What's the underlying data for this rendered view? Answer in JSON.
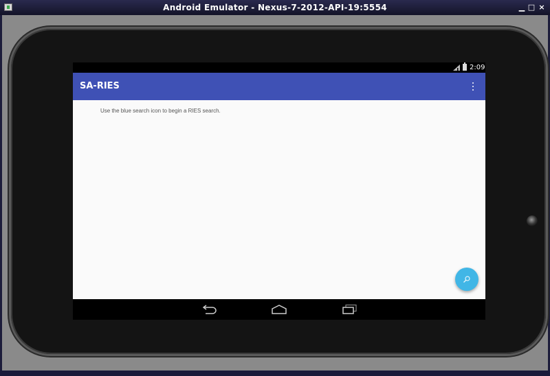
{
  "window": {
    "title": "Android Emulator - Nexus-7-2012-API-19:5554",
    "buttons": {
      "minimize": "▁",
      "maximize": "□",
      "close": "×"
    }
  },
  "status_bar": {
    "time": "2:09",
    "icons": [
      "signal-icon",
      "battery-icon"
    ]
  },
  "app_bar": {
    "title": "SA-RIES",
    "menu_icon": "overflow-menu-icon"
  },
  "content": {
    "hint": "Use the blue search icon to begin a RIES search."
  },
  "fab": {
    "icon": "search-icon",
    "color": "#41b6e6"
  },
  "nav_bar": {
    "icons": [
      "back-icon",
      "home-icon",
      "recents-icon"
    ]
  },
  "colors": {
    "app_bar": "#3f51b5",
    "screen_background": "#fafafa",
    "fab": "#41b6e6"
  }
}
